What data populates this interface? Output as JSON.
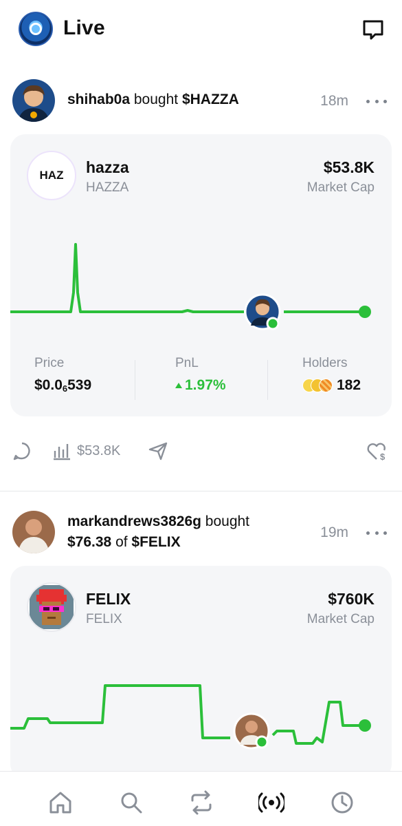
{
  "header": {
    "title": "Live",
    "icons": [
      "app-avatar",
      "message-icon"
    ]
  },
  "posts": [
    {
      "user": "shihab0a",
      "action_text": " bought ",
      "token_symbol": "$HAZZA",
      "time": "18m",
      "card": {
        "logo_text": "HAZ",
        "name": "hazza",
        "ticker": "HAZZA",
        "market_cap": "$53.8K",
        "market_cap_label": "Market Cap",
        "stats": {
          "price_label": "Price",
          "price_value": "$0.0",
          "price_subscript": "6",
          "price_tail": "539",
          "pnl_label": "PnL",
          "pnl_value": "1.97%",
          "holders_label": "Holders",
          "holders_value": "182"
        }
      },
      "actions": {
        "volume": "$53.8K"
      }
    },
    {
      "user": "markandrews3826g",
      "action_text": " bought",
      "amount_line_amount": "$76.38",
      "amount_line_of": " of ",
      "token_symbol": "$FELIX",
      "time": "19m",
      "card": {
        "name": "FELIX",
        "ticker": "FELIX",
        "market_cap": "$760K",
        "market_cap_label": "Market Cap"
      }
    }
  ],
  "bottom_nav": [
    "home-icon",
    "search-icon",
    "swap-icon",
    "live-icon",
    "history-icon"
  ],
  "colors": {
    "accent_green": "#2bbf3a",
    "muted_text": "#8a8f98",
    "card_bg": "#f5f6f8"
  }
}
